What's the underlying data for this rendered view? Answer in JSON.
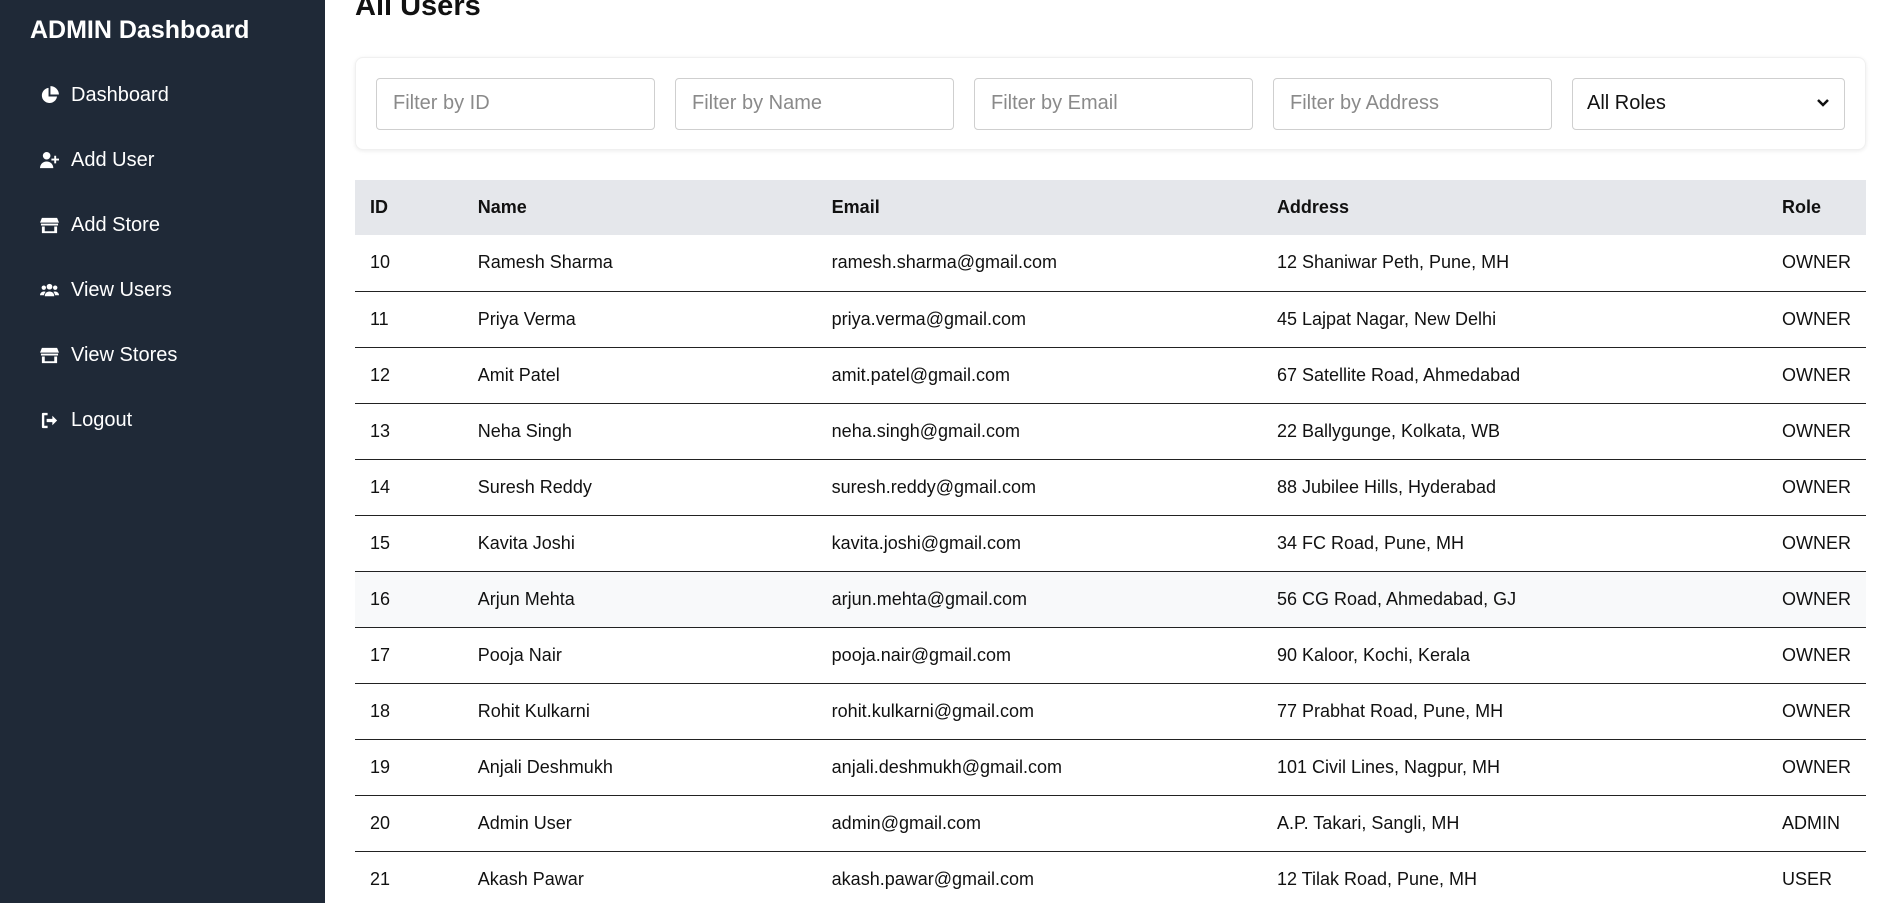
{
  "sidebar": {
    "brand": "ADMIN Dashboard",
    "items": [
      {
        "label": "Dashboard",
        "icon": "pie-chart-icon"
      },
      {
        "label": "Add User",
        "icon": "user-plus-icon"
      },
      {
        "label": "Add Store",
        "icon": "store-icon"
      },
      {
        "label": "View Users",
        "icon": "users-icon"
      },
      {
        "label": "View Stores",
        "icon": "store-icon"
      },
      {
        "label": "Logout",
        "icon": "sign-out-icon"
      }
    ]
  },
  "main": {
    "title": "All Users",
    "filters": {
      "id_placeholder": "Filter by ID",
      "name_placeholder": "Filter by Name",
      "email_placeholder": "Filter by Email",
      "address_placeholder": "Filter by Address",
      "role_selected": "All Roles"
    },
    "table": {
      "headers": [
        "ID",
        "Name",
        "Email",
        "Address",
        "Role"
      ],
      "rows": [
        {
          "id": "10",
          "name": "Ramesh Sharma",
          "email": "ramesh.sharma@gmail.com",
          "address": "12 Shaniwar Peth, Pune, MH",
          "role": "OWNER"
        },
        {
          "id": "11",
          "name": "Priya Verma",
          "email": "priya.verma@gmail.com",
          "address": "45 Lajpat Nagar, New Delhi",
          "role": "OWNER"
        },
        {
          "id": "12",
          "name": "Amit Patel",
          "email": "amit.patel@gmail.com",
          "address": "67 Satellite Road, Ahmedabad",
          "role": "OWNER"
        },
        {
          "id": "13",
          "name": "Neha Singh",
          "email": "neha.singh@gmail.com",
          "address": "22 Ballygunge, Kolkata, WB",
          "role": "OWNER"
        },
        {
          "id": "14",
          "name": "Suresh Reddy",
          "email": "suresh.reddy@gmail.com",
          "address": "88 Jubilee Hills, Hyderabad",
          "role": "OWNER"
        },
        {
          "id": "15",
          "name": "Kavita Joshi",
          "email": "kavita.joshi@gmail.com",
          "address": "34 FC Road, Pune, MH",
          "role": "OWNER"
        },
        {
          "id": "16",
          "name": "Arjun Mehta",
          "email": "arjun.mehta@gmail.com",
          "address": "56 CG Road, Ahmedabad, GJ",
          "role": "OWNER"
        },
        {
          "id": "17",
          "name": "Pooja Nair",
          "email": "pooja.nair@gmail.com",
          "address": "90 Kaloor, Kochi, Kerala",
          "role": "OWNER"
        },
        {
          "id": "18",
          "name": "Rohit Kulkarni",
          "email": "rohit.kulkarni@gmail.com",
          "address": "77 Prabhat Road, Pune, MH",
          "role": "OWNER"
        },
        {
          "id": "19",
          "name": "Anjali Deshmukh",
          "email": "anjali.deshmukh@gmail.com",
          "address": "101 Civil Lines, Nagpur, MH",
          "role": "OWNER"
        },
        {
          "id": "20",
          "name": "Admin User",
          "email": "admin@gmail.com",
          "address": "A.P. Takari, Sangli, MH",
          "role": "ADMIN"
        },
        {
          "id": "21",
          "name": "Akash Pawar",
          "email": "akash.pawar@gmail.com",
          "address": "12 Tilak Road, Pune, MH",
          "role": "USER"
        }
      ]
    }
  },
  "colors": {
    "sidebar_bg": "#1f2937",
    "table_header_bg": "#e5e7eb",
    "row_hover_bg": "#f8f9fa"
  }
}
